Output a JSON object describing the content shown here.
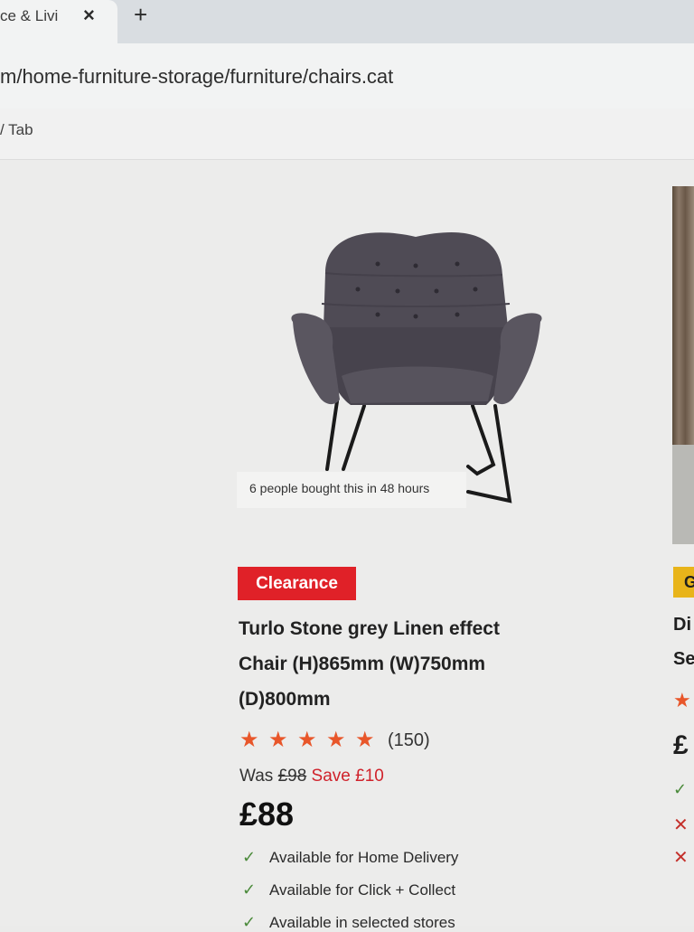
{
  "browser": {
    "tab_title": "ce & Livi",
    "tab_close_icon": "×",
    "new_tab_icon": "+",
    "url": "m/home-furniture-storage/furniture/chairs.cat",
    "bookmark_item": "/ Tab"
  },
  "product": {
    "social_proof": "6 people bought this in 48 hours",
    "badge": "Clearance",
    "title_line1": "Turlo Stone grey Linen effect",
    "title_line2": "Chair (H)865mm (W)750mm",
    "title_line3": "(D)800mm",
    "rating_stars": 5,
    "review_count": "(150)",
    "was_label": "Was ",
    "was_price": "£98",
    "save_text": " Save £10",
    "price": "£88",
    "availability": [
      "Available for Home Delivery",
      "Available for Click + Collect",
      "Available in selected stores"
    ]
  },
  "next_card": {
    "badge_initial": "G",
    "title_1": "Di",
    "title_2": "Se",
    "price": "£",
    "check_icon": "✓",
    "cross_icon": "✕"
  },
  "colors": {
    "clearance_red": "#e02128",
    "star_orange": "#e8562a",
    "save_red": "#d0222b",
    "check_green": "#4a8a3a"
  }
}
